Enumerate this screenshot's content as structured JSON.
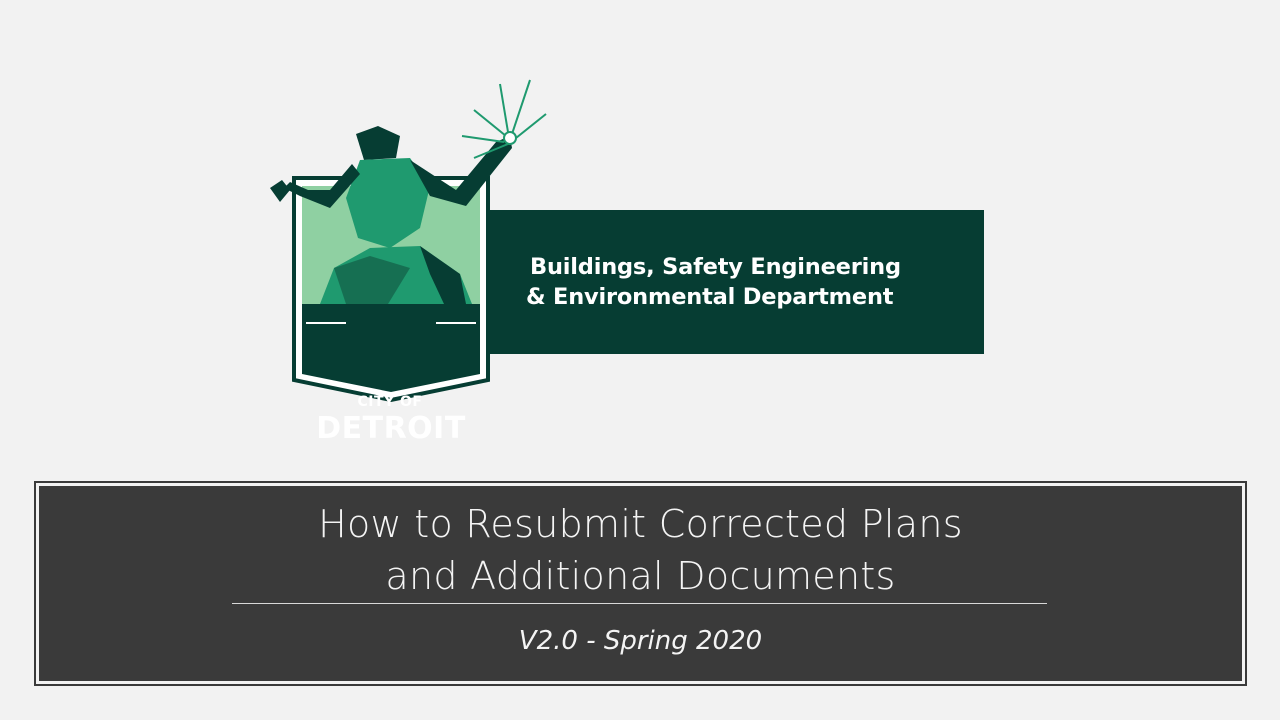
{
  "logo": {
    "city_of": "CITY OF",
    "detroit": "DETROIT",
    "colors": {
      "dark_green": "#063d33",
      "mid_green": "#1f9a6f",
      "light_green": "#8fd0a2"
    }
  },
  "department": {
    "line1": "Buildings, Safety Engineering",
    "line2": "& Environmental Department"
  },
  "title": {
    "line1": "How to Resubmit Corrected Plans",
    "line2": "and Additional Documents",
    "version": "V2.0 - Spring 2020"
  },
  "colors": {
    "background": "#f2f2f2",
    "panel": "#3a3a3a",
    "text_light": "#f4f4f4"
  }
}
